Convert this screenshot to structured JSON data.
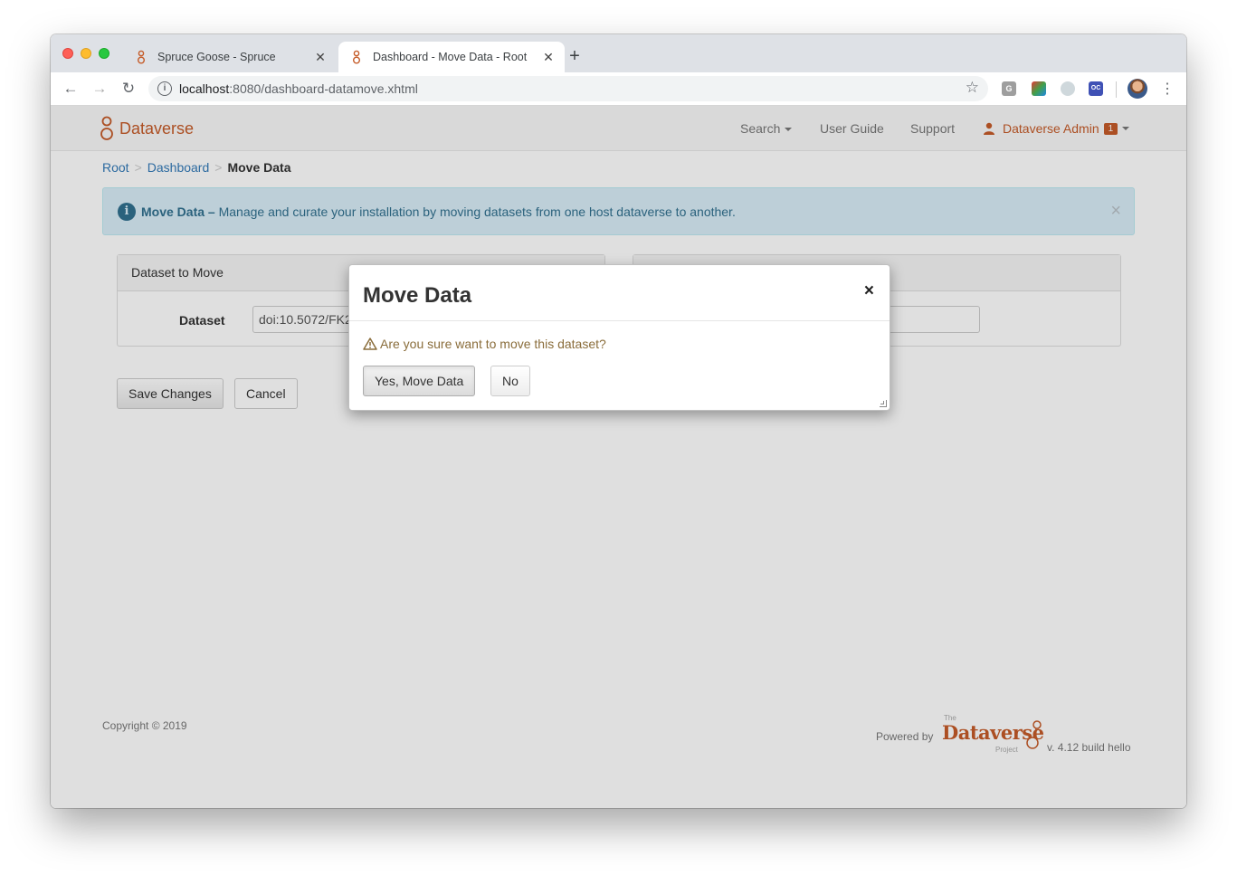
{
  "browser": {
    "tabs": [
      {
        "title": "Spruce Goose - Spruce",
        "close": "✕"
      },
      {
        "title": "Dashboard - Move Data - Root",
        "close": "✕"
      }
    ],
    "new_tab": "+",
    "url_host": "localhost",
    "url_rest": ":8080/dashboard-datamove.xhtml"
  },
  "navbar": {
    "brand": "Dataverse",
    "search": "Search",
    "user_guide": "User Guide",
    "support": "Support",
    "user": "Dataverse Admin",
    "notification_count": "1"
  },
  "breadcrumb": {
    "root": "Root",
    "dashboard": "Dashboard",
    "current": "Move Data",
    "separator": ">"
  },
  "alert": {
    "title": "Move Data",
    "dash": " – ",
    "message": "Manage and curate your installation by moving datasets from one host dataverse to another."
  },
  "form": {
    "left_heading": "Dataset to Move",
    "dataset_label": "Dataset",
    "dataset_value": "doi:10.5072/FK2",
    "save_label": "Save Changes",
    "cancel_label": "Cancel"
  },
  "modal": {
    "title": "Move Data",
    "close": "×",
    "warning": "Are you sure want to move this dataset?",
    "yes_label": "Yes, Move Data",
    "no_label": "No"
  },
  "footer": {
    "copyright": "Copyright © 2019",
    "powered_by": "Powered by",
    "logo_the": "The",
    "logo_name": "Dataverse",
    "logo_project": "Project",
    "version": "v. 4.12 build hello"
  },
  "colors": {
    "brand": "#c55b28",
    "link": "#337ab7",
    "alert_bg": "#d9edf7",
    "warning_text": "#8a6d3b"
  }
}
